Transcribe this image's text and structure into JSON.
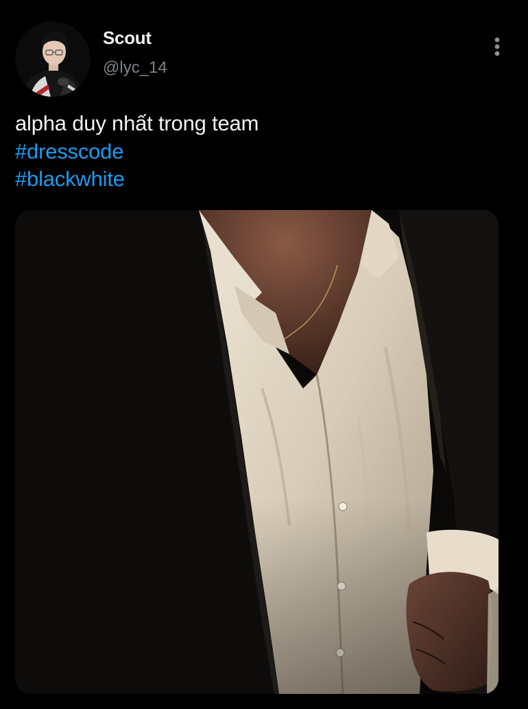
{
  "tweet": {
    "author": {
      "display_name": "Scout",
      "handle": "@lyc_14",
      "avatar_icon": "profile-photo"
    },
    "more_icon": "more-vertical-icon",
    "text": "alpha duy nhất trong team",
    "hashtags": [
      "#dresscode",
      "#blackwhite"
    ],
    "media": {
      "kind": "photo"
    },
    "colors": {
      "background": "#000000",
      "text": "#f3f3f3",
      "handle": "#7e8389",
      "hashtag": "#1d9bf0"
    }
  }
}
